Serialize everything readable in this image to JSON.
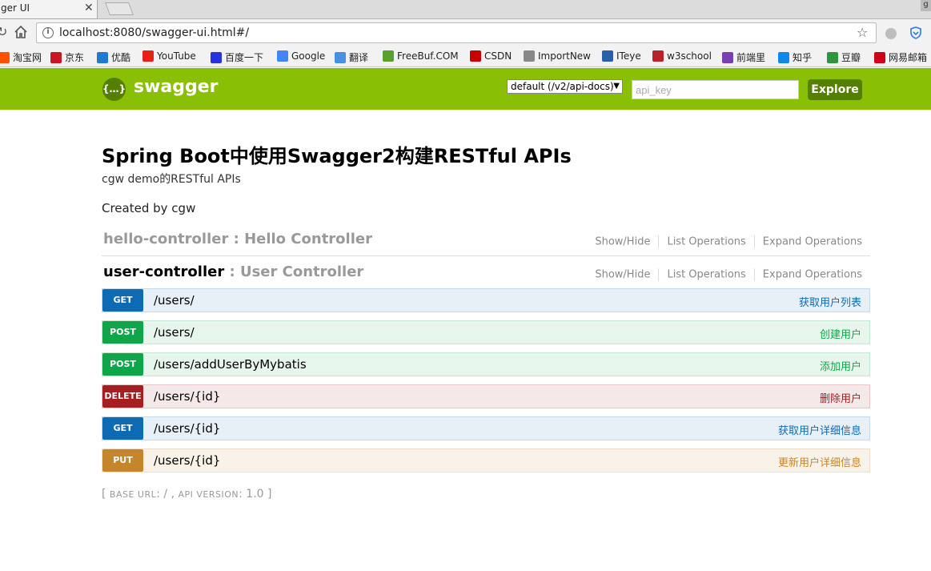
{
  "browser": {
    "tab_title": "ger UI",
    "tab_close": "✕",
    "profile_initial": "g",
    "url": "localhost:8080/swagger-ui.html#/",
    "bookmarks": [
      {
        "label": "淘宝网",
        "icon": "taobao-icon",
        "color": "#ff5000"
      },
      {
        "label": "京东",
        "icon": "jd-icon",
        "color": "#c91623"
      },
      {
        "label": "优酷",
        "icon": "youku-icon",
        "color": "#1f78d1"
      },
      {
        "label": "YouTube",
        "icon": "youtube-icon",
        "color": "#e62117"
      },
      {
        "label": "百度一下",
        "icon": "baidu-icon",
        "color": "#2932e1"
      },
      {
        "label": "Google",
        "icon": "google-icon",
        "color": "#4285f4"
      },
      {
        "label": "翻译",
        "icon": "translate-icon",
        "color": "#4a90e2"
      },
      {
        "label": "FreeBuf.COM",
        "icon": "freebuf-icon",
        "color": "#5aa02c"
      },
      {
        "label": "CSDN",
        "icon": "csdn-icon",
        "color": "#c70000"
      },
      {
        "label": "ImportNew",
        "icon": "importnew-icon",
        "color": "#888888"
      },
      {
        "label": "ITeye",
        "icon": "iteye-icon",
        "color": "#2b5ea8"
      },
      {
        "label": "w3school",
        "icon": "w3school-icon",
        "color": "#b8232a"
      },
      {
        "label": "前端里",
        "icon": "qianduanli-icon",
        "color": "#7a3fb0"
      },
      {
        "label": "知乎",
        "icon": "zhihu-icon",
        "color": "#0f88eb"
      },
      {
        "label": "豆瓣",
        "icon": "douban-icon",
        "color": "#2e963d"
      },
      {
        "label": "网易邮箱",
        "icon": "netease-mail-icon",
        "color": "#d0021b"
      }
    ]
  },
  "swagger": {
    "logo_glyph": "{…}",
    "logo_text": "swagger",
    "spec_select": "default (/v2/api-docs)",
    "api_key_placeholder": "api_key",
    "explore_label": "Explore",
    "brand_color": "#89bf04",
    "brand_dark": "#547f00"
  },
  "info": {
    "title": "Spring Boot中使用Swagger2构建RESTful APIs",
    "description": "cgw demo的RESTful APIs",
    "created_by": "Created by cgw"
  },
  "resources": [
    {
      "name": "hello-controller",
      "sep": " : ",
      "description": "Hello Controller",
      "show_hide": "Show/Hide",
      "list_ops": "List Operations",
      "expand_ops": "Expand Operations"
    },
    {
      "name": "user-controller",
      "sep": " : ",
      "description": "User Controller",
      "show_hide": "Show/Hide",
      "list_ops": "List Operations",
      "expand_ops": "Expand Operations"
    }
  ],
  "operations": [
    {
      "method": "GET",
      "path": "/users/",
      "summary": "获取用户列表"
    },
    {
      "method": "POST",
      "path": "/users/",
      "summary": "创建用户"
    },
    {
      "method": "POST",
      "path": "/users/addUserByMybatis",
      "summary": "添加用户"
    },
    {
      "method": "DELETE",
      "path": "/users/{id}",
      "summary": "删除用户"
    },
    {
      "method": "GET",
      "path": "/users/{id}",
      "summary": "获取用户详细信息"
    },
    {
      "method": "PUT",
      "path": "/users/{id}",
      "summary": "更新用户详细信息"
    }
  ],
  "footer": {
    "open": "[ ",
    "base_url_label": "base url",
    "base_url_value": ": / , ",
    "api_version_label": "api version",
    "api_version_value": ": 1.0 ]"
  }
}
